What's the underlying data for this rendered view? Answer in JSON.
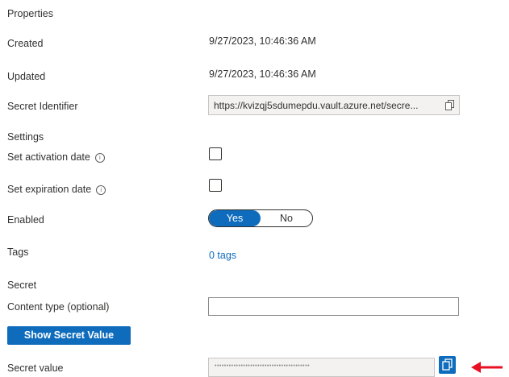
{
  "properties": {
    "heading": "Properties",
    "created_label": "Created",
    "created_value": "9/27/2023, 10:46:36 AM",
    "updated_label": "Updated",
    "updated_value": "9/27/2023, 10:46:36 AM",
    "secret_identifier_label": "Secret Identifier",
    "secret_identifier_value": "https://kvizqj5sdumepdu.vault.azure.net/secre..."
  },
  "settings": {
    "heading": "Settings",
    "activation_label": "Set activation date",
    "expiration_label": "Set expiration date",
    "enabled_label": "Enabled",
    "enabled_options": [
      "Yes",
      "No"
    ],
    "enabled_selected": "Yes",
    "tags_label": "Tags",
    "tags_link": "0 tags"
  },
  "secret": {
    "heading": "Secret",
    "content_type_label": "Content type (optional)",
    "content_type_value": "",
    "show_button_label": "Show Secret Value",
    "secret_value_label": "Secret value",
    "secret_value_masked": "••••••••••••••••••••••••••••••••••••••••"
  },
  "icons": {
    "info": "info-icon",
    "copy": "copy-icon",
    "arrow": "arrow-left-icon"
  },
  "colors": {
    "accent": "#0f6cbd",
    "arrow": "#e81123",
    "text": "#323130"
  }
}
